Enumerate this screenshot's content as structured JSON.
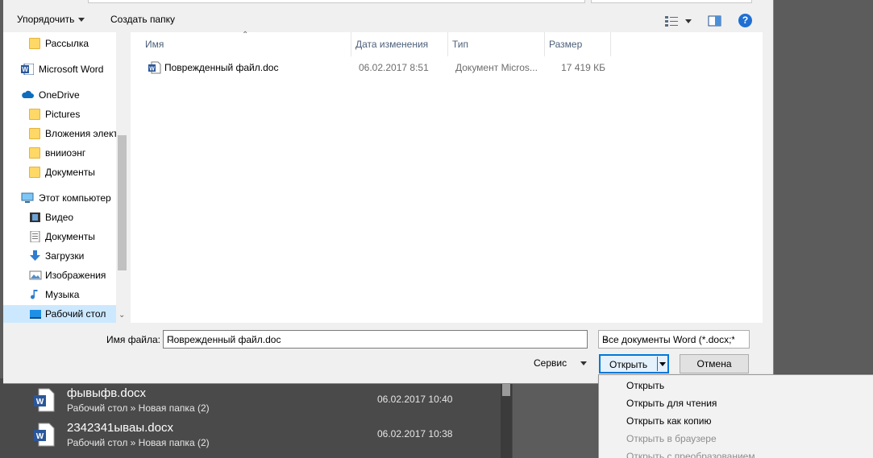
{
  "toolbar": {
    "organize_label": "Упорядочить",
    "new_folder_label": "Создать папку",
    "help_label": "?"
  },
  "nav": {
    "items": [
      {
        "label": "Рассылка",
        "icon": "folder-icon"
      },
      {
        "label": "Microsoft Word",
        "icon": "word-icon"
      },
      {
        "label": "OneDrive",
        "icon": "cloud-icon"
      },
      {
        "label": "Pictures",
        "icon": "folder-icon"
      },
      {
        "label": "Вложения элект",
        "icon": "folder-icon"
      },
      {
        "label": "внииоэнг",
        "icon": "folder-icon"
      },
      {
        "label": "Документы",
        "icon": "folder-icon"
      },
      {
        "label": "Этот компьютер",
        "icon": "computer-icon"
      },
      {
        "label": "Видео",
        "icon": "video-icon"
      },
      {
        "label": "Документы",
        "icon": "documents-icon"
      },
      {
        "label": "Загрузки",
        "icon": "download-icon"
      },
      {
        "label": "Изображения",
        "icon": "pictures-icon"
      },
      {
        "label": "Музыка",
        "icon": "music-icon"
      },
      {
        "label": "Рабочий стол",
        "icon": "desktop-icon",
        "selected": true
      }
    ]
  },
  "columns": {
    "name": "Имя",
    "date": "Дата изменения",
    "type": "Тип",
    "size": "Размер"
  },
  "files": [
    {
      "name": "Поврежденный файл.doc",
      "date": "06.02.2017 8:51",
      "type": "Документ Micros...",
      "size": "17 419 КБ"
    }
  ],
  "bottom": {
    "filename_label": "Имя файла:",
    "filename_value": "Поврежденный файл.doc",
    "filter_value": "Все документы Word (*.docx;*",
    "service_label": "Сервис",
    "open_label": "Открыть",
    "cancel_label": "Отмена"
  },
  "open_menu": [
    {
      "label": "Открыть",
      "enabled": true
    },
    {
      "label": "Открыть для чтения",
      "enabled": true
    },
    {
      "label": "Открыть как копию",
      "enabled": true
    },
    {
      "label": "Открыть в браузере",
      "enabled": false
    },
    {
      "label": "Открыть с преобразованием",
      "enabled": false
    }
  ],
  "background_recent": [
    {
      "name": "фывыфв.docx",
      "path": "Рабочий стол » Новая папка (2)",
      "date": "06.02.2017 10:40"
    },
    {
      "name": "2342341ываы.docx",
      "path": "Рабочий стол » Новая папка (2)",
      "date": "06.02.2017 10:38"
    }
  ],
  "colors": {
    "accent": "#0078d7",
    "selected_nav": "#cce8ff",
    "word_blue": "#2b579a"
  }
}
